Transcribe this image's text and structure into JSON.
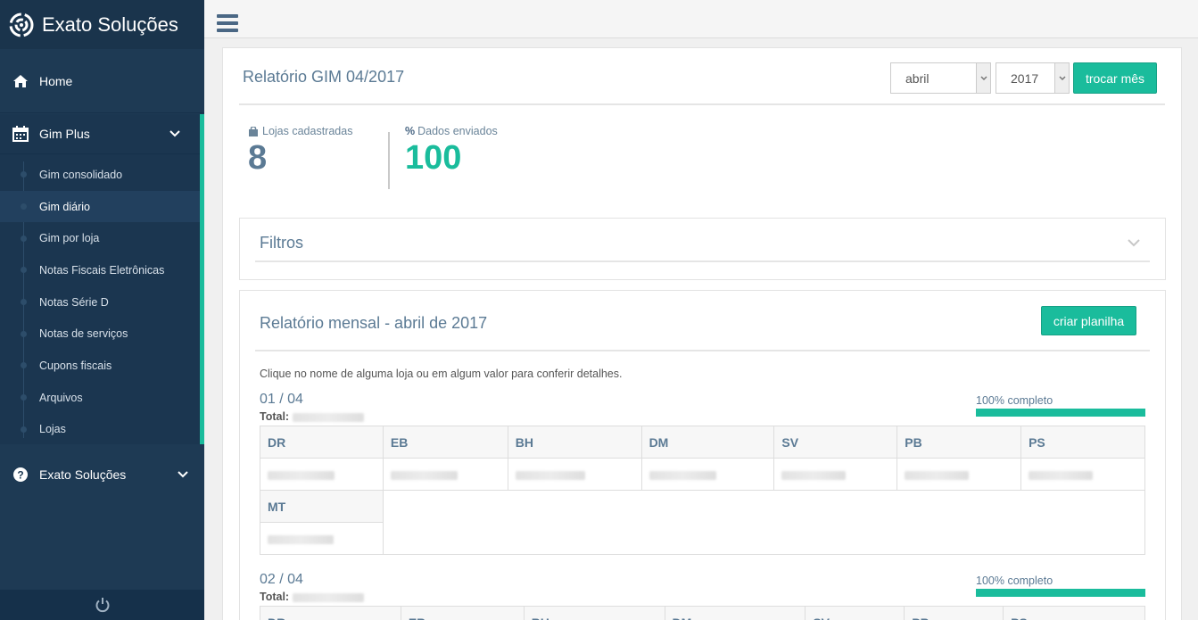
{
  "brand": {
    "name": "Exato Soluções"
  },
  "sidebar": {
    "home_label": "Home",
    "group_label": "Gim Plus",
    "sub_items": [
      {
        "label": "Gim consolidado"
      },
      {
        "label": "Gim diário"
      },
      {
        "label": "Gim por loja"
      },
      {
        "label": "Notas Fiscais Eletrônicas"
      },
      {
        "label": "Notas Série D"
      },
      {
        "label": "Notas de serviços"
      },
      {
        "label": "Cupons fiscais"
      },
      {
        "label": "Arquivos"
      },
      {
        "label": "Lojas"
      }
    ],
    "active_index": 1,
    "bottom_label": "Exato Soluções"
  },
  "header": {
    "title": "Relatório GIM 04/2017",
    "month_value": "abril",
    "year_value": "2017",
    "change_button": "trocar mês"
  },
  "stats": {
    "stores_label": "Lojas cadastradas",
    "stores_value": "8",
    "sent_label": "Dados enviados",
    "sent_value": "100"
  },
  "filters": {
    "title": "Filtros"
  },
  "report": {
    "title": "Relatório mensal - abril de 2017",
    "create_button": "criar planilha",
    "hint": "Clique no nome de alguma loja ou em algum valor para conferir detalhes.",
    "total_label": "Total:",
    "days": [
      {
        "date": "01 / 04",
        "progress_label": "100% completo",
        "progress": 1.0
      },
      {
        "date": "02 / 04",
        "progress_label": "100% completo",
        "progress": 1.0
      }
    ],
    "stores": [
      "DR",
      "EB",
      "BH",
      "DM",
      "SV",
      "PB",
      "PS",
      "MT"
    ]
  },
  "colors": {
    "accent": "#1abc9c",
    "sidebar": "#1e3a54",
    "title": "#5b7a94"
  }
}
